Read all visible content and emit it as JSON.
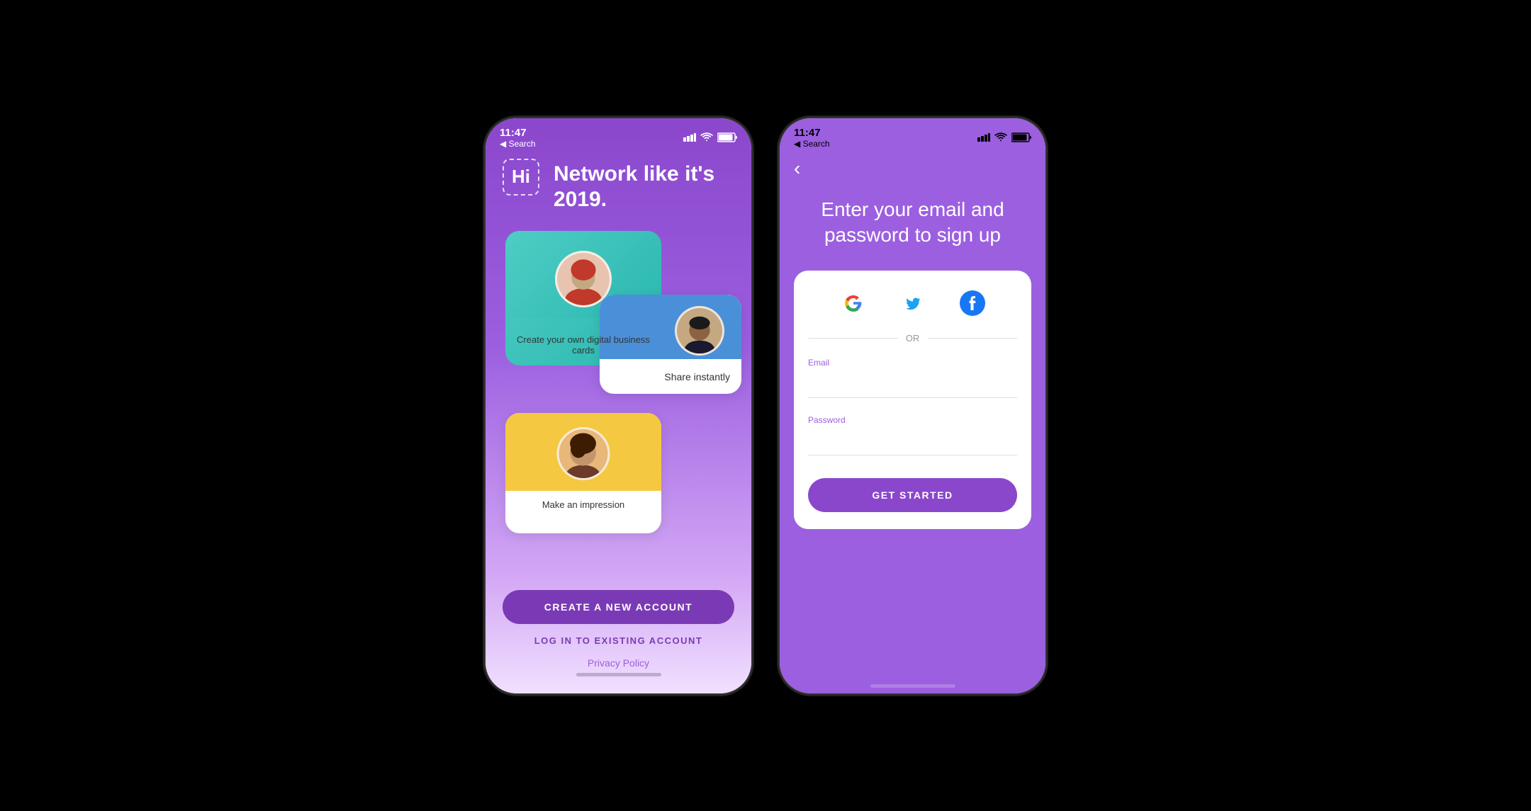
{
  "screen1": {
    "status": {
      "time": "11:47",
      "nav_label": "◀ Search",
      "signal": "▐▐▐",
      "wifi": "wifi",
      "battery": "battery"
    },
    "logo": "Hi",
    "title": "Network like it's 2019.",
    "card1": {
      "text": "Create your own digital business cards"
    },
    "card2": {
      "text": "Share instantly"
    },
    "card3": {
      "text": "Make an impression"
    },
    "btn_create": "CREATE A NEW ACCOUNT",
    "btn_login": "LOG IN TO EXISTING ACCOUNT",
    "btn_privacy": "Privacy Policy"
  },
  "screen2": {
    "status": {
      "time": "11:47",
      "nav_label": "◀ Search",
      "signal": "▐▐▐",
      "wifi": "wifi",
      "battery": "battery"
    },
    "back_arrow": "‹",
    "title": "Enter your email and password to sign up",
    "or_label": "OR",
    "email_label": "Email",
    "email_placeholder": "",
    "password_label": "Password",
    "password_placeholder": "",
    "btn_get_started": "GET STARTED"
  }
}
